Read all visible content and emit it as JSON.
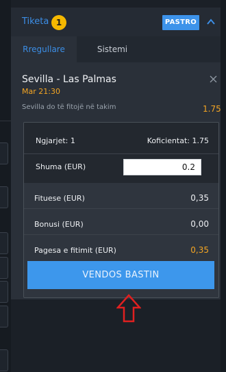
{
  "header": {
    "title": "Tiketa",
    "count": "1",
    "clear_label": "PASTRO"
  },
  "tabs": [
    {
      "label": "Rregullare",
      "active": true
    },
    {
      "label": "Sistemi",
      "active": false
    }
  ],
  "selection": {
    "match": "Sevilla - Las Palmas",
    "datetime": "Mar 21:30",
    "market": "Sevilla do të fitojë në takim",
    "odds": "1.75"
  },
  "slip": {
    "events_label": "Ngjarjet: 1",
    "odds_label": "Koficientat: 1.75",
    "stake_label": "Shuma (EUR)",
    "stake_value": "0.2",
    "winnings_label": "Fituese (EUR)",
    "winnings_value": "0,35",
    "bonus_label": "Bonusi (EUR)",
    "bonus_value": "0,00",
    "payout_label": "Pagesa e fitimit (EUR)",
    "payout_value": "0,35",
    "place_bet_label": "VENDOS BASTIN"
  },
  "colors": {
    "accent_blue": "#3d93ea",
    "odds_orange": "#f5a623",
    "badge_yellow": "#f5b800",
    "annotation_red": "#e02020"
  }
}
